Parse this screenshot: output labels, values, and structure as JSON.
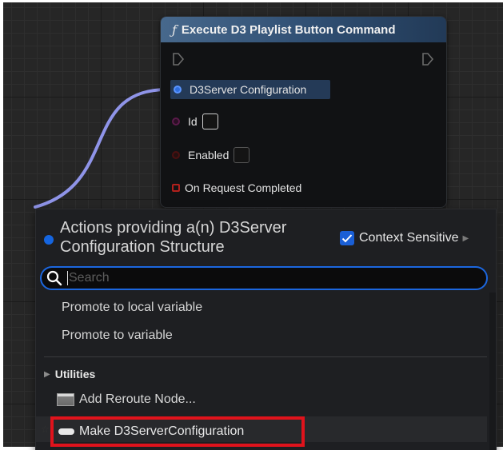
{
  "node": {
    "title": "Execute D3 Playlist Button Command",
    "function_icon": "ƒ",
    "pins": {
      "config_label": "D3Server Configuration",
      "id_label": "Id",
      "enabled_label": "Enabled",
      "request_label": "On Request Completed"
    }
  },
  "menu": {
    "title": "Actions providing a(n) D3Server Configuration Structure",
    "context_label": "Context Sensitive",
    "context_checked": true,
    "search_placeholder": "Search",
    "search_value": "",
    "items": {
      "promote_local": "Promote to local variable",
      "promote_var": "Promote to variable"
    },
    "category": "Utilities",
    "reroute_label": "Add Reroute Node...",
    "make_label": "Make D3ServerConfiguration"
  },
  "colors": {
    "accent_blue": "#1c67df",
    "highlight_red": "#e0131c",
    "struct_pin": "#1565e0",
    "wire": "#8f94e8"
  },
  "icons": [
    "function-icon",
    "exec-pin-icon",
    "struct-pin-icon",
    "search-icon",
    "check-icon",
    "chevron-right-icon",
    "reroute-node-icon",
    "struct-make-icon"
  ]
}
